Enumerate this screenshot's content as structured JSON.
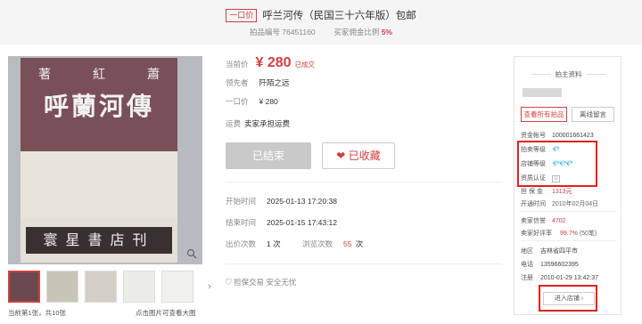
{
  "header": {
    "tag": "一口价",
    "title": "呼兰河传（民国三十六年版）包邮",
    "item_no_label": "拍品编号",
    "item_no": "76451160",
    "commission_label": "买家佣金比例",
    "commission": "5%"
  },
  "gallery": {
    "book_author_chars": [
      "蕭",
      "紅",
      "著"
    ],
    "book_title": "呼蘭河傳",
    "book_publisher": "寰星書店刊",
    "page_info": "当前第1张，共10张",
    "hint": "点击图片可查看大图"
  },
  "info": {
    "current_price_label": "当前价",
    "current_price": "¥ 280",
    "sold_text": "已成交",
    "leader_label": "领先者",
    "leader": "阡陌之远",
    "fixed_price_label": "一口价",
    "fixed_price": "¥ 280",
    "shipping_label": "运费",
    "shipping": "卖家承担运费",
    "ended_button": "已结束",
    "fav_button": "已收藏",
    "start_label": "开始时间",
    "start_time": "2025-01-13 17:20:38",
    "end_label": "结束时间",
    "end_time": "2025-01-15 17:43:12",
    "bids_label": "出价次数",
    "bids": "1 次",
    "views_label": "浏览次数",
    "views": "55",
    "views_unit": "次",
    "guarantee": "担保交易 安全无忧"
  },
  "seller": {
    "title": "拍主资料",
    "btn_all": "查看所有拍品",
    "btn_msg": "离线留言",
    "account_label": "资金帐号",
    "account": "100001661423",
    "auction_level_label": "拍卖等级",
    "auction_level": "💎",
    "shop_level_label": "店铺等级",
    "shop_level": "💎💎💎",
    "cert_label": "资质认证",
    "cert": "认",
    "deposit_label": "担 保 金",
    "deposit": "1313元",
    "open_label": "开通时间",
    "open_time": "2010年02月04日",
    "credit_label": "卖家信誉",
    "credit": "4702",
    "rating_label": "卖家好评率",
    "rating": "99.7%",
    "rating_count": "(50笔)",
    "region_label": "地区",
    "region": "吉林省四平市",
    "phone_label": "电话",
    "phone": "13596602395",
    "reg_label": "注册",
    "reg_time": "2010-01-29 13:42:37",
    "enter_shop": "进入店铺 ›"
  },
  "colors": {
    "accent": "#d04040",
    "highlight_box": "#e02020"
  }
}
